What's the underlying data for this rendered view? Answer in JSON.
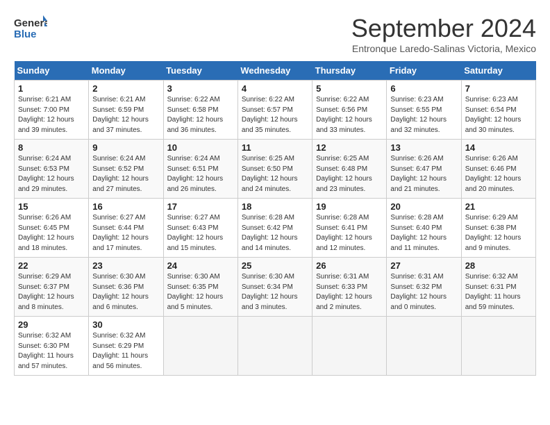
{
  "header": {
    "logo_general": "General",
    "logo_blue": "Blue",
    "month_title": "September 2024",
    "subtitle": "Entronque Laredo-Salinas Victoria, Mexico"
  },
  "weekdays": [
    "Sunday",
    "Monday",
    "Tuesday",
    "Wednesday",
    "Thursday",
    "Friday",
    "Saturday"
  ],
  "weeks": [
    [
      {
        "day": "1",
        "info": "Sunrise: 6:21 AM\nSunset: 7:00 PM\nDaylight: 12 hours\nand 39 minutes."
      },
      {
        "day": "2",
        "info": "Sunrise: 6:21 AM\nSunset: 6:59 PM\nDaylight: 12 hours\nand 37 minutes."
      },
      {
        "day": "3",
        "info": "Sunrise: 6:22 AM\nSunset: 6:58 PM\nDaylight: 12 hours\nand 36 minutes."
      },
      {
        "day": "4",
        "info": "Sunrise: 6:22 AM\nSunset: 6:57 PM\nDaylight: 12 hours\nand 35 minutes."
      },
      {
        "day": "5",
        "info": "Sunrise: 6:22 AM\nSunset: 6:56 PM\nDaylight: 12 hours\nand 33 minutes."
      },
      {
        "day": "6",
        "info": "Sunrise: 6:23 AM\nSunset: 6:55 PM\nDaylight: 12 hours\nand 32 minutes."
      },
      {
        "day": "7",
        "info": "Sunrise: 6:23 AM\nSunset: 6:54 PM\nDaylight: 12 hours\nand 30 minutes."
      }
    ],
    [
      {
        "day": "8",
        "info": "Sunrise: 6:24 AM\nSunset: 6:53 PM\nDaylight: 12 hours\nand 29 minutes."
      },
      {
        "day": "9",
        "info": "Sunrise: 6:24 AM\nSunset: 6:52 PM\nDaylight: 12 hours\nand 27 minutes."
      },
      {
        "day": "10",
        "info": "Sunrise: 6:24 AM\nSunset: 6:51 PM\nDaylight: 12 hours\nand 26 minutes."
      },
      {
        "day": "11",
        "info": "Sunrise: 6:25 AM\nSunset: 6:50 PM\nDaylight: 12 hours\nand 24 minutes."
      },
      {
        "day": "12",
        "info": "Sunrise: 6:25 AM\nSunset: 6:48 PM\nDaylight: 12 hours\nand 23 minutes."
      },
      {
        "day": "13",
        "info": "Sunrise: 6:26 AM\nSunset: 6:47 PM\nDaylight: 12 hours\nand 21 minutes."
      },
      {
        "day": "14",
        "info": "Sunrise: 6:26 AM\nSunset: 6:46 PM\nDaylight: 12 hours\nand 20 minutes."
      }
    ],
    [
      {
        "day": "15",
        "info": "Sunrise: 6:26 AM\nSunset: 6:45 PM\nDaylight: 12 hours\nand 18 minutes."
      },
      {
        "day": "16",
        "info": "Sunrise: 6:27 AM\nSunset: 6:44 PM\nDaylight: 12 hours\nand 17 minutes."
      },
      {
        "day": "17",
        "info": "Sunrise: 6:27 AM\nSunset: 6:43 PM\nDaylight: 12 hours\nand 15 minutes."
      },
      {
        "day": "18",
        "info": "Sunrise: 6:28 AM\nSunset: 6:42 PM\nDaylight: 12 hours\nand 14 minutes."
      },
      {
        "day": "19",
        "info": "Sunrise: 6:28 AM\nSunset: 6:41 PM\nDaylight: 12 hours\nand 12 minutes."
      },
      {
        "day": "20",
        "info": "Sunrise: 6:28 AM\nSunset: 6:40 PM\nDaylight: 12 hours\nand 11 minutes."
      },
      {
        "day": "21",
        "info": "Sunrise: 6:29 AM\nSunset: 6:38 PM\nDaylight: 12 hours\nand 9 minutes."
      }
    ],
    [
      {
        "day": "22",
        "info": "Sunrise: 6:29 AM\nSunset: 6:37 PM\nDaylight: 12 hours\nand 8 minutes."
      },
      {
        "day": "23",
        "info": "Sunrise: 6:30 AM\nSunset: 6:36 PM\nDaylight: 12 hours\nand 6 minutes."
      },
      {
        "day": "24",
        "info": "Sunrise: 6:30 AM\nSunset: 6:35 PM\nDaylight: 12 hours\nand 5 minutes."
      },
      {
        "day": "25",
        "info": "Sunrise: 6:30 AM\nSunset: 6:34 PM\nDaylight: 12 hours\nand 3 minutes."
      },
      {
        "day": "26",
        "info": "Sunrise: 6:31 AM\nSunset: 6:33 PM\nDaylight: 12 hours\nand 2 minutes."
      },
      {
        "day": "27",
        "info": "Sunrise: 6:31 AM\nSunset: 6:32 PM\nDaylight: 12 hours\nand 0 minutes."
      },
      {
        "day": "28",
        "info": "Sunrise: 6:32 AM\nSunset: 6:31 PM\nDaylight: 11 hours\nand 59 minutes."
      }
    ],
    [
      {
        "day": "29",
        "info": "Sunrise: 6:32 AM\nSunset: 6:30 PM\nDaylight: 11 hours\nand 57 minutes."
      },
      {
        "day": "30",
        "info": "Sunrise: 6:32 AM\nSunset: 6:29 PM\nDaylight: 11 hours\nand 56 minutes."
      },
      {
        "day": "",
        "info": ""
      },
      {
        "day": "",
        "info": ""
      },
      {
        "day": "",
        "info": ""
      },
      {
        "day": "",
        "info": ""
      },
      {
        "day": "",
        "info": ""
      }
    ]
  ]
}
